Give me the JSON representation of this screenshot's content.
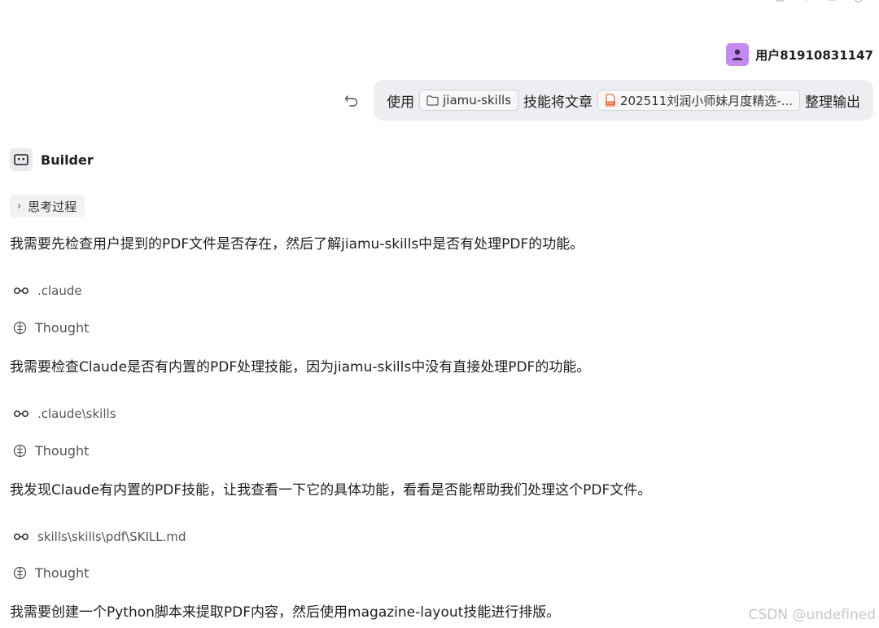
{
  "user": {
    "name": "用户81910831147"
  },
  "message": {
    "prefix": "使用",
    "skill_chip": "jiamu-skills",
    "middle": "技能将文章",
    "file_chip": "202511刘润小师妹月度精选-...",
    "suffix": "整理输出"
  },
  "agent": {
    "name": "Builder",
    "thinking_label": "思考过程"
  },
  "steps": [
    {
      "text": "我需要先检查用户提到的PDF文件是否存在，然后了解jiamu-skills中是否有处理PDF的功能。"
    },
    {
      "tool": ".claude",
      "thought": "Thought",
      "text": "我需要检查Claude是否有内置的PDF处理技能，因为jiamu-skills中没有直接处理PDF的功能。"
    },
    {
      "tool": ".claude\\skills",
      "thought": "Thought",
      "text": "我发现Claude有内置的PDF技能，让我查看一下它的具体功能，看看是否能帮助我们处理这个PDF文件。"
    },
    {
      "tool": "skills\\skills\\pdf\\SKILL.md",
      "thought": "Thought",
      "text": "我需要创建一个Python脚本来提取PDF内容，然后使用magazine-layout技能进行排版。"
    }
  ],
  "watermark": "CSDN @undefined",
  "colors": {
    "user_avatar": "#c58af0",
    "bubble_bg": "#eceef2",
    "chip_border": "#cfd2d8",
    "pdf_icon": "#f26b3a"
  }
}
